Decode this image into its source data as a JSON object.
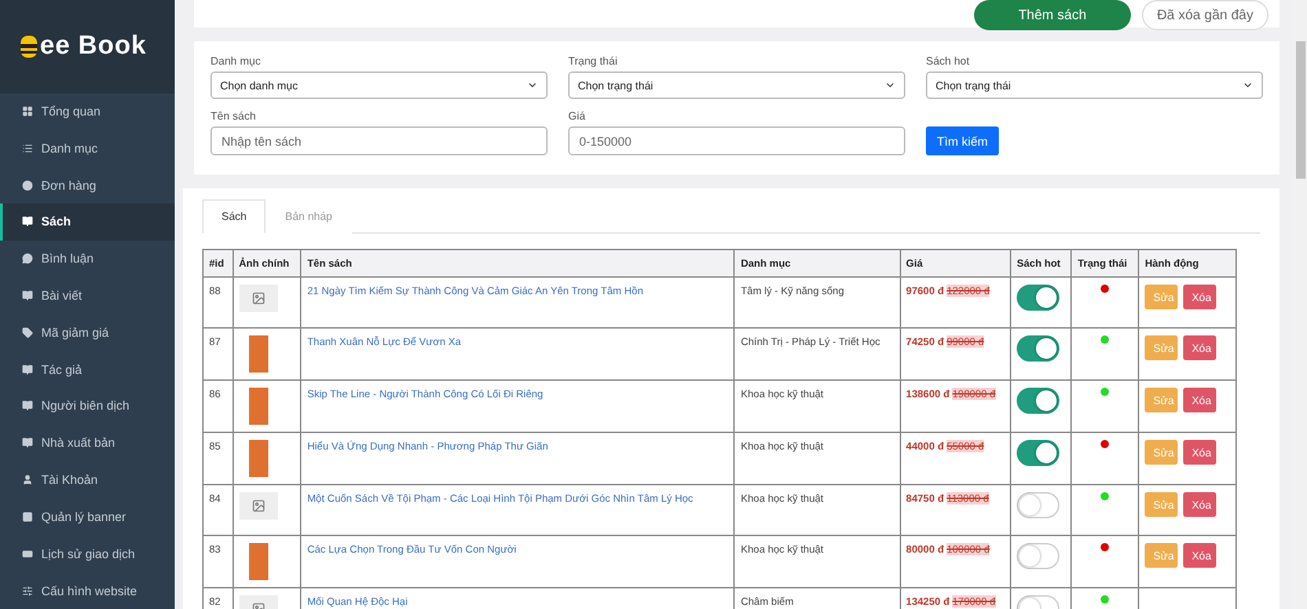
{
  "sidebar": {
    "logo": "ee Book",
    "items": [
      {
        "label": "Tổng quan",
        "selected": false
      },
      {
        "label": "Danh mục",
        "selected": false
      },
      {
        "label": "Đơn hàng",
        "selected": false
      },
      {
        "label": "Sách",
        "selected": true
      },
      {
        "label": "Bình luận",
        "selected": false
      },
      {
        "label": "Bài viết",
        "selected": false
      },
      {
        "label": "Mã giảm giá",
        "selected": false
      },
      {
        "label": "Tác giả",
        "selected": false
      },
      {
        "label": "Người biên dịch",
        "selected": false
      },
      {
        "label": "Nhà xuất bản",
        "selected": false
      },
      {
        "label": "Tài Khoản",
        "selected": false
      },
      {
        "label": "Quản lý banner",
        "selected": false
      },
      {
        "label": "Lịch sử giao dịch",
        "selected": false
      },
      {
        "label": "Cấu hình website",
        "selected": false
      }
    ]
  },
  "top_actions": {
    "add_button": "Thêm sách",
    "deleted_button": "Đã xóa gần đây"
  },
  "filters": {
    "selects": [
      {
        "label": "Danh mục",
        "value": "Chọn danh mục"
      },
      {
        "label": "Trạng thái",
        "value": "Chọn trạng thái"
      },
      {
        "label": "Sách hot",
        "value": "Chọn trạng thái"
      }
    ],
    "inputs": [
      {
        "label": "Tên sách",
        "placeholder": "Nhập tên sách"
      },
      {
        "label": "Giá",
        "placeholder": "0-150000"
      }
    ],
    "search_button": "Tìm kiếm"
  },
  "tabs": [
    {
      "label": "Sách",
      "selected": true
    },
    {
      "label": "Bản nháp",
      "selected": false
    }
  ],
  "table": {
    "columns": [
      "#id",
      "Ảnh chính",
      "Tên sách",
      "Danh mục",
      "Giá",
      "Sách hot",
      "Trạng thái",
      "Hành động"
    ],
    "rows": [
      {
        "id": "88",
        "thumbnail": {
          "kind": "placeholder"
        },
        "title": "21 Ngày Tìm Kiếm Sự Thành Công Và Cảm Giác An Yên Trong Tâm Hồn",
        "category": "Tâm lý - Kỹ năng sống",
        "price": "97600 đ",
        "old_price": "122000 đ",
        "hot": true,
        "status": {
          "color": "#e00000"
        },
        "edit": "Sửa",
        "delete": "Xóa"
      },
      {
        "id": "87",
        "thumbnail": {
          "kind": "cover"
        },
        "title": "Thanh Xuân Nỗ Lực Để Vươn Xa",
        "category": "Chính Trị - Pháp Lý - Triết Học",
        "price": "74250 đ",
        "old_price": "99000 đ",
        "hot": true,
        "status": {
          "color": "#22dd22"
        },
        "edit": "Sửa",
        "delete": "Xóa"
      },
      {
        "id": "86",
        "thumbnail": {
          "kind": "cover"
        },
        "title": "Skip The Line - Người Thành Công Có Lối Đi Riêng",
        "category": "Khoa học kỹ thuật",
        "price": "138600 đ",
        "old_price": "198000 đ",
        "hot": true,
        "status": {
          "color": "#22dd22"
        },
        "edit": "Sửa",
        "delete": "Xóa"
      },
      {
        "id": "85",
        "thumbnail": {
          "kind": "cover"
        },
        "title": "Hiểu Và Ứng Dụng Nhanh - Phương Pháp Thư Giãn",
        "category": "Khoa học kỹ thuật",
        "price": "44000 đ",
        "old_price": "55000 đ",
        "hot": true,
        "status": {
          "color": "#e00000"
        },
        "edit": "Sửa",
        "delete": "Xóa"
      },
      {
        "id": "84",
        "thumbnail": {
          "kind": "placeholder"
        },
        "title": "Một Cuốn Sách Về Tội Phạm - Các Loại Hình Tội Phạm Dưới Góc Nhìn Tâm Lý Học",
        "category": "Khoa học kỹ thuật",
        "price": "84750 đ",
        "old_price": "113000 đ",
        "hot": false,
        "status": {
          "color": "#22dd22"
        },
        "edit": "Sửa",
        "delete": "Xóa"
      },
      {
        "id": "83",
        "thumbnail": {
          "kind": "cover"
        },
        "title": "Các Lựa Chọn Trong Đầu Tư Vốn Con Người",
        "category": "Khoa học kỹ thuật",
        "price": "80000 đ",
        "old_price": "100000 đ",
        "hot": false,
        "status": {
          "color": "#e00000"
        },
        "edit": "Sửa",
        "delete": "Xóa"
      },
      {
        "id": "82",
        "thumbnail": {
          "kind": "placeholder"
        },
        "title": "Mối Quan Hệ Độc Hại",
        "category": "Châm biếm",
        "price": "134250 đ",
        "old_price": "179000 đ",
        "hot": false,
        "status": {
          "color": "#22dd22"
        }
      }
    ]
  }
}
